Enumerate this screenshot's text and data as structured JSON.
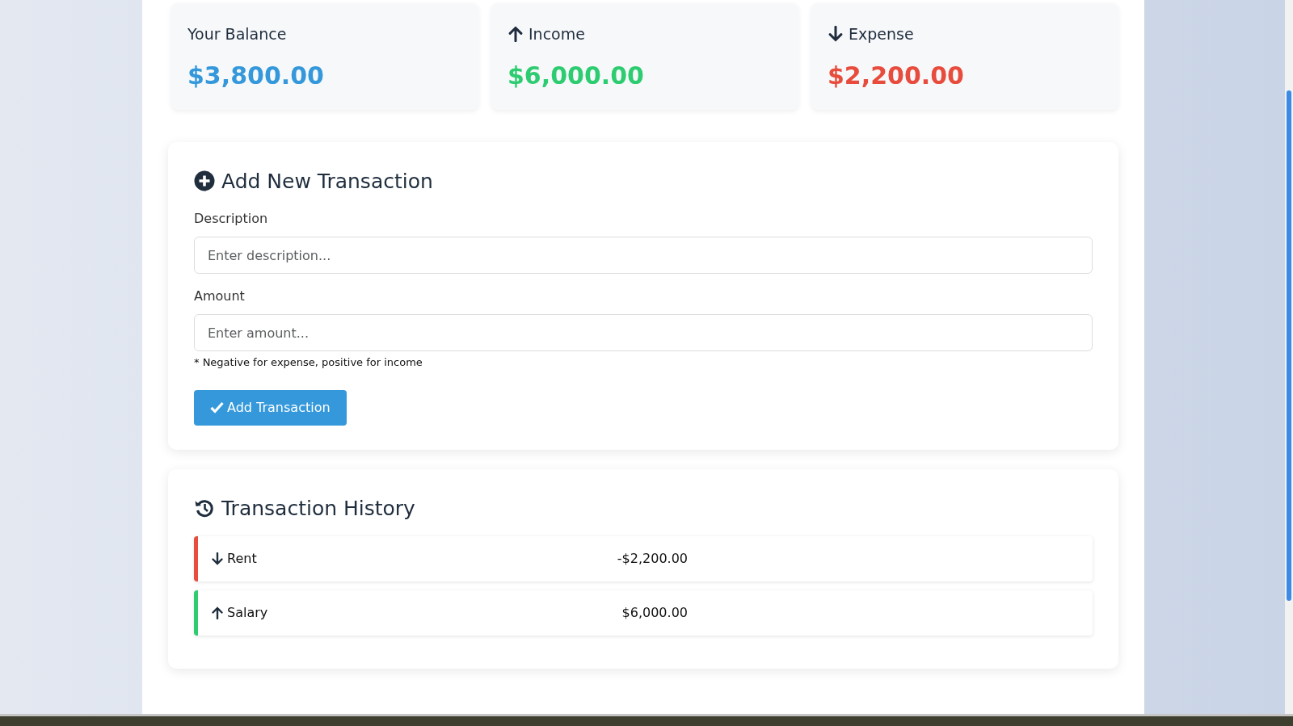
{
  "summary": [
    {
      "kind": "balance",
      "label": "Your Balance",
      "value": "$3,800.00",
      "color": "#3498db"
    },
    {
      "kind": "income",
      "label": "Income",
      "value": "$6,000.00",
      "color": "#2ecc71"
    },
    {
      "kind": "expense",
      "label": "Expense",
      "value": "$2,200.00",
      "color": "#e74c3c"
    }
  ],
  "add_form": {
    "title": "Add New Transaction",
    "fields": [
      {
        "label": "Description",
        "placeholder": "Enter description..."
      },
      {
        "label": "Amount",
        "placeholder": "Enter amount...",
        "hint": "* Negative for expense, positive for income"
      }
    ],
    "submit": "Add Transaction"
  },
  "history": {
    "title": "Transaction History",
    "items": [
      {
        "kind": "expense",
        "name": "Rent",
        "amount": "-$2,200.00",
        "color": "#e74c3c"
      },
      {
        "kind": "income",
        "name": "Salary",
        "amount": "$6,000.00",
        "color": "#2ecc71"
      }
    ]
  }
}
